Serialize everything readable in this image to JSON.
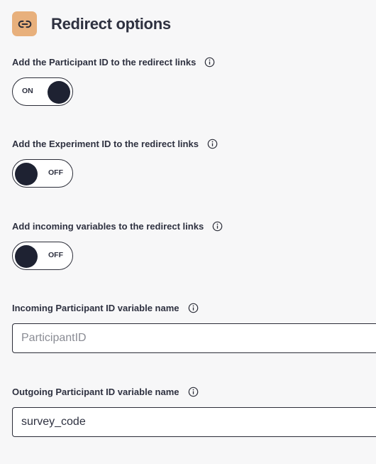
{
  "header": {
    "title": "Redirect options",
    "icon": "link-icon",
    "icon_bg": "#e8b07c"
  },
  "fields": {
    "participant_id_toggle": {
      "label": "Add the Participant ID to the redirect links",
      "state": "ON"
    },
    "experiment_id_toggle": {
      "label": "Add the Experiment ID to the redirect links",
      "state": "OFF"
    },
    "incoming_variables_toggle": {
      "label": "Add incoming variables to the redirect links",
      "state": "OFF"
    },
    "incoming_participant_id": {
      "label": "Incoming Participant ID variable name",
      "value": "",
      "placeholder": "ParticipantID"
    },
    "outgoing_participant_id": {
      "label": "Outgoing Participant ID variable name",
      "value": "survey_code",
      "placeholder": ""
    }
  },
  "colors": {
    "background": "#f7f7f8",
    "text": "#2e3140",
    "knob": "#1e2232",
    "accent": "#e8b07c"
  }
}
